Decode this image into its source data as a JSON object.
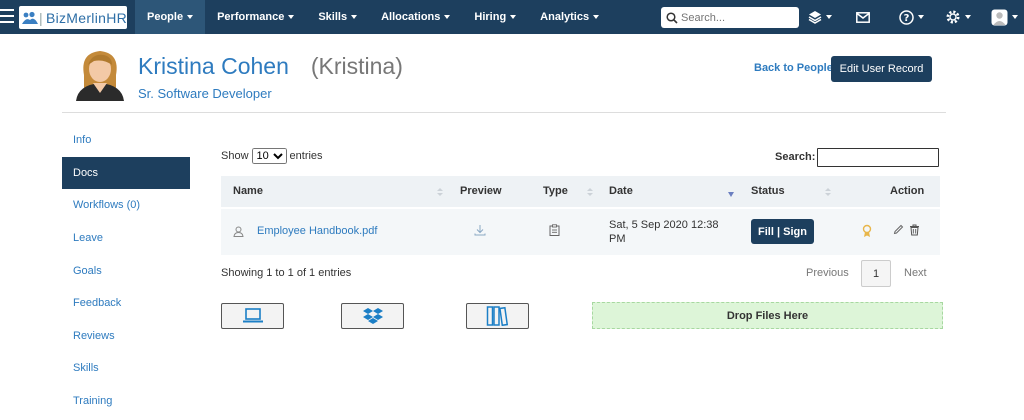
{
  "app": {
    "logo_text": "BizMerlinHR"
  },
  "nav": {
    "items": [
      {
        "label": "People",
        "active": true
      },
      {
        "label": "Performance"
      },
      {
        "label": "Skills"
      },
      {
        "label": "Allocations"
      },
      {
        "label": "Hiring"
      },
      {
        "label": "Analytics"
      }
    ],
    "search_placeholder": "Search..."
  },
  "profile": {
    "name": "Kristina Cohen",
    "nickname": "(Kristina)",
    "title": "Sr. Software Developer",
    "back_label": "Back to People",
    "edit_label": "Edit User Record"
  },
  "sidebar": {
    "items": [
      {
        "label": "Info"
      },
      {
        "label": "Docs",
        "active": true
      },
      {
        "label": "Workflows (0)"
      },
      {
        "label": "Leave"
      },
      {
        "label": "Goals"
      },
      {
        "label": "Feedback"
      },
      {
        "label": "Reviews"
      },
      {
        "label": "Skills"
      },
      {
        "label": "Training"
      }
    ]
  },
  "table": {
    "show_label": "Show",
    "entries_value": "10",
    "entries_label": "entries",
    "search_label": "Search:",
    "columns": [
      "Name",
      "Preview",
      "Type",
      "Date",
      "Status",
      "Action"
    ],
    "rows": [
      {
        "name": "Employee Handbook.pdf",
        "date": "Sat, 5 Sep 2020 12:38 PM",
        "status_button": "Fill | Sign"
      }
    ],
    "info": "Showing 1 to 1 of 1 entries",
    "previous": "Previous",
    "page": "1",
    "next": "Next"
  },
  "upload": {
    "drop_label": "Drop Files Here"
  },
  "colors": {
    "nav_bg": "#1d3f5e",
    "link": "#2e7bbf",
    "drop_bg": "#ddf5d8"
  }
}
